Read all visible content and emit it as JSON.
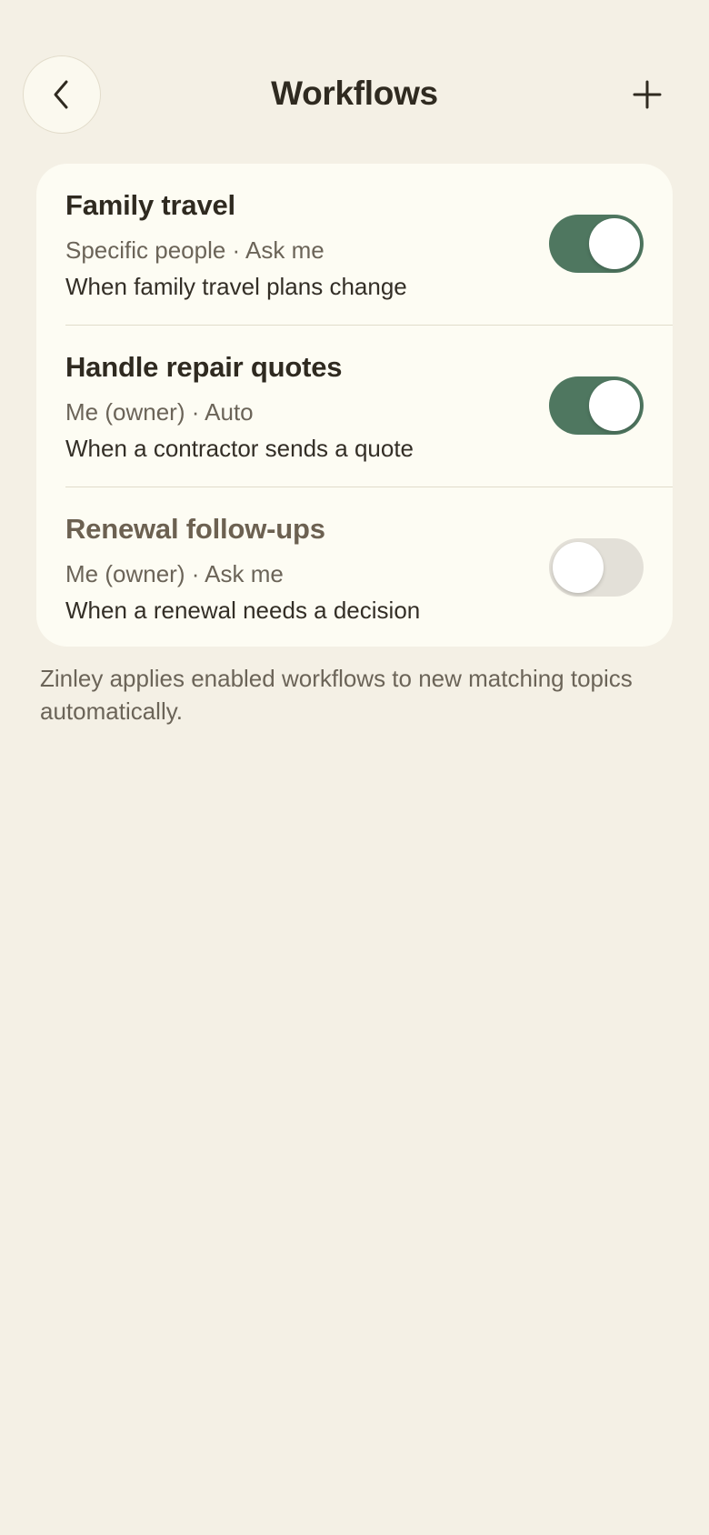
{
  "header": {
    "title": "Workflows",
    "back_icon": "chevron-left-icon",
    "add_icon": "plus-icon"
  },
  "workflows": [
    {
      "title": "Family travel",
      "meta": "Specific people · Ask me",
      "trigger": "When family travel plans change",
      "enabled": true
    },
    {
      "title": "Handle repair quotes",
      "meta": "Me (owner) · Auto",
      "trigger": "When a contractor sends a quote",
      "enabled": true
    },
    {
      "title": "Renewal follow-ups",
      "meta": "Me (owner) · Ask me",
      "trigger": "When a renewal needs a decision",
      "enabled": false
    }
  ],
  "footnote": "Zinley applies enabled workflows to new matching topics automatically.",
  "colors": {
    "background": "#f4f0e5",
    "card": "#fdfcf3",
    "toggle_on": "#4f7760",
    "toggle_off": "#e3e0d8"
  }
}
